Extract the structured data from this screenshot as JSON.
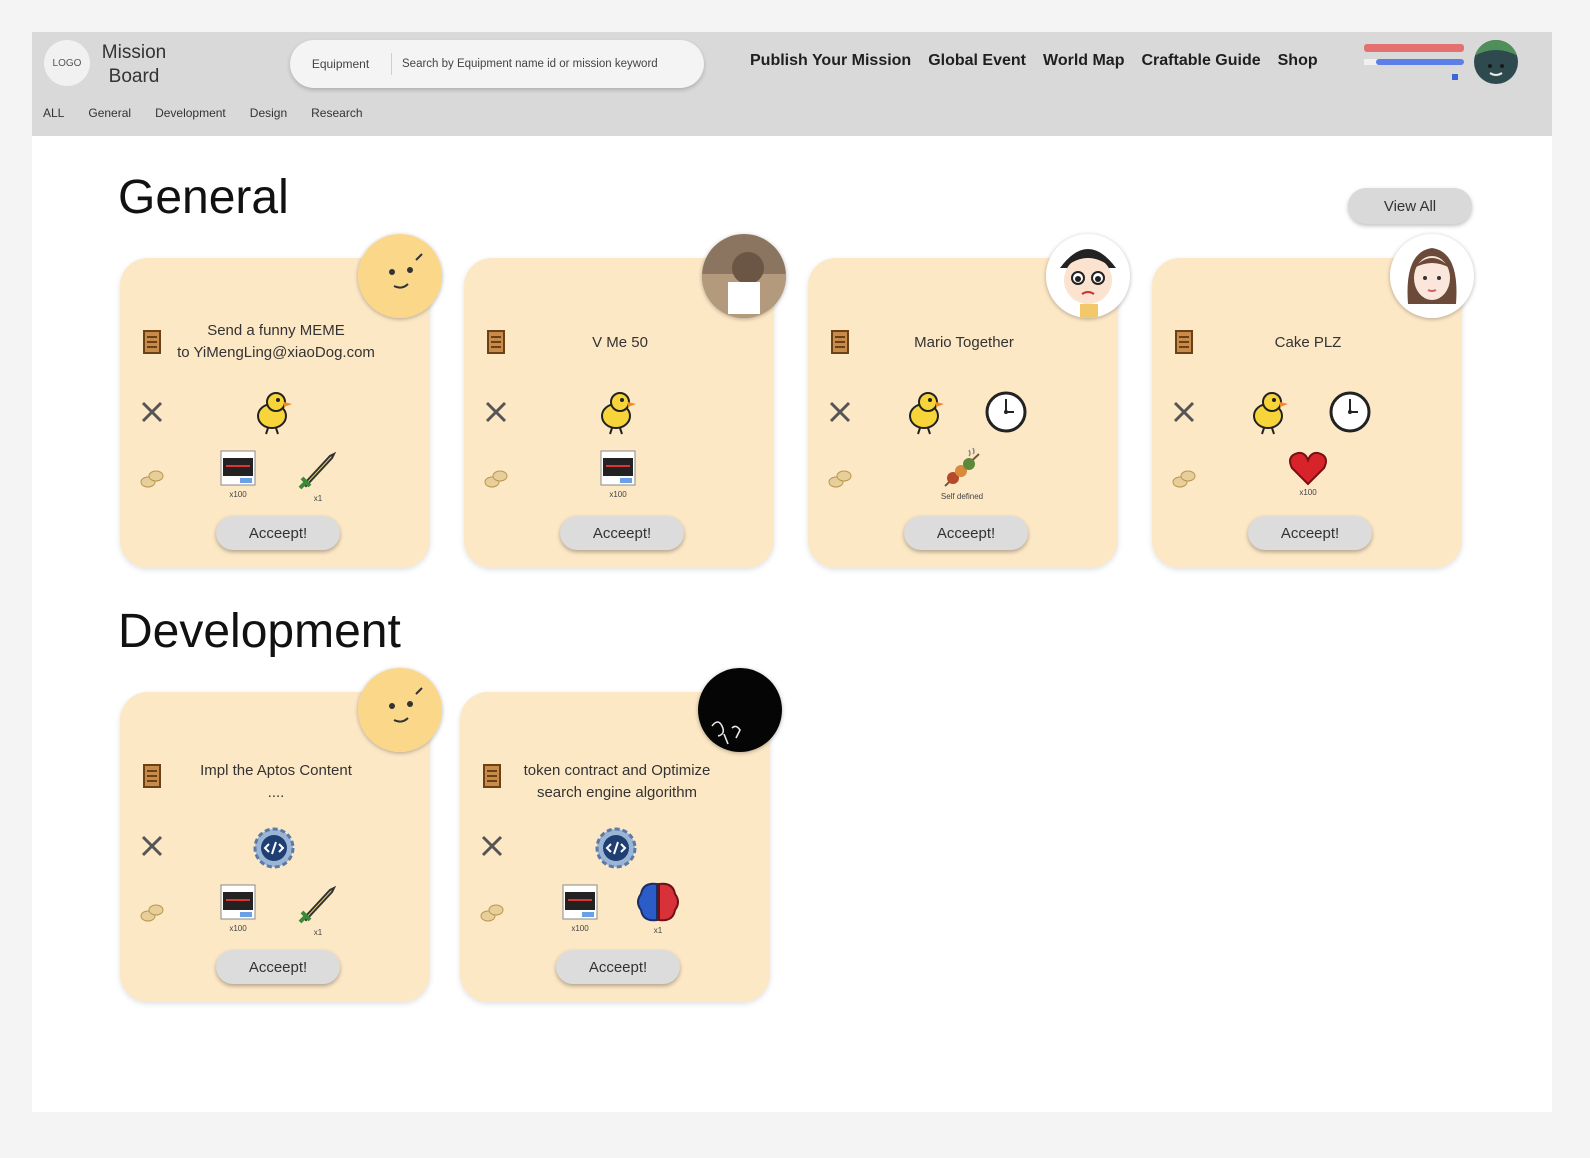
{
  "header": {
    "logo_text": "LOGO",
    "brand_line1": "Mission",
    "brand_line2": "Board",
    "search_category": "Equipment",
    "search_placeholder": "Search by Equipment name id or mission keyword",
    "nav": [
      "Publish Your Mission",
      "Global Event",
      "World Map",
      "Craftable Guide",
      "Shop"
    ],
    "tabs": [
      "ALL",
      "General",
      "Development",
      "Design",
      "Research"
    ]
  },
  "sections": {
    "general": {
      "title": "General",
      "view_all": "View All",
      "cards": [
        {
          "title_line1": "Send a funny MEME",
          "title_line2": "to YiMengLing@xiaoDog.com",
          "requirements": [
            "duck-icon"
          ],
          "rewards": [
            {
              "icon": "currency-card-icon",
              "qty": "x100"
            },
            {
              "icon": "sword-icon",
              "qty": "x1"
            }
          ],
          "accept": "Acceept!"
        },
        {
          "title_line1": "V Me 50",
          "title_line2": "",
          "requirements": [
            "duck-icon"
          ],
          "rewards": [
            {
              "icon": "currency-card-icon",
              "qty": "x100"
            }
          ],
          "accept": "Acceept!"
        },
        {
          "title_line1": "Mario Together",
          "title_line2": "",
          "requirements": [
            "duck-icon",
            "clock-icon"
          ],
          "rewards": [
            {
              "icon": "skewer-icon",
              "qty": "Self defined"
            }
          ],
          "accept": "Acceept!"
        },
        {
          "title_line1": "Cake PLZ",
          "title_line2": "",
          "requirements": [
            "duck-icon",
            "clock-icon"
          ],
          "rewards": [
            {
              "icon": "heart-icon",
              "qty": "x100"
            }
          ],
          "accept": "Acceept!"
        }
      ]
    },
    "development": {
      "title": "Development",
      "cards": [
        {
          "title_line1": "Impl the Aptos Content",
          "title_line2": "....",
          "requirements": [
            "code-gear-icon"
          ],
          "rewards": [
            {
              "icon": "currency-card-icon",
              "qty": "x100"
            },
            {
              "icon": "sword-icon",
              "qty": "x1"
            }
          ],
          "accept": "Acceept!"
        },
        {
          "title_line1": "token contract and Optimize",
          "title_line2": "search engine algorithm",
          "requirements": [
            "code-gear-icon"
          ],
          "rewards": [
            {
              "icon": "currency-card-icon",
              "qty": "x100"
            },
            {
              "icon": "brain-icon",
              "qty": "x1"
            }
          ],
          "accept": "Acceept!"
        }
      ]
    }
  },
  "colors": {
    "header_bg": "#d9d9d9",
    "card_bg": "#fde8c6",
    "button_bg": "#dcdcdc",
    "status_red": "#e47070",
    "status_blue": "#5b7fe6"
  }
}
